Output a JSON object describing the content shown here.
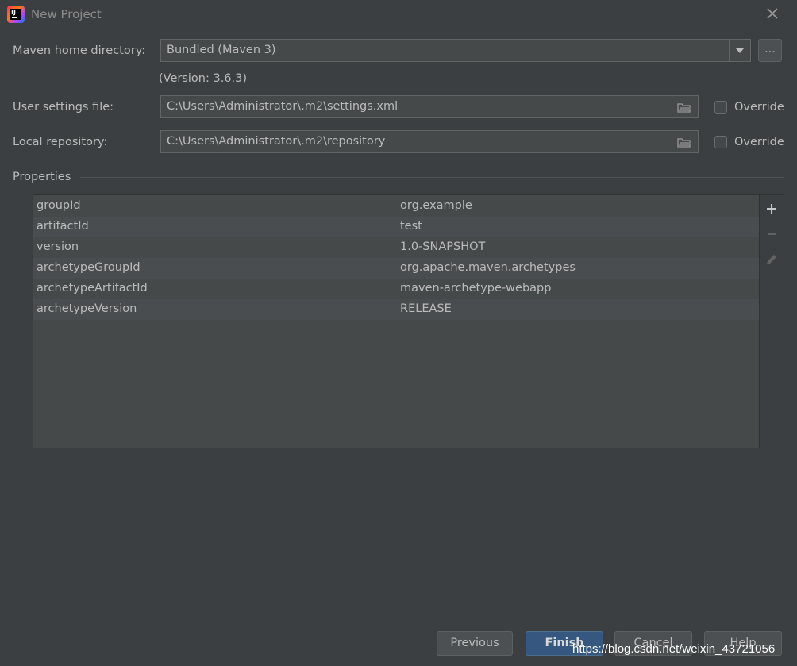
{
  "window": {
    "title": "New Project",
    "app_icon_text": "IJ"
  },
  "maven_home": {
    "label": "Maven home directory:",
    "value": "Bundled (Maven 3)",
    "version": "(Version: 3.6.3)",
    "browse_label": "..."
  },
  "user_settings": {
    "label": "User settings file:",
    "value": "C:\\Users\\Administrator\\.m2\\settings.xml",
    "override_label": "Override",
    "override_checked": false
  },
  "local_repo": {
    "label": "Local repository:",
    "value": "C:\\Users\\Administrator\\.m2\\repository",
    "override_label": "Override",
    "override_checked": false
  },
  "properties": {
    "title": "Properties",
    "rows": [
      {
        "key": "groupId",
        "value": "org.example"
      },
      {
        "key": "artifactId",
        "value": "test"
      },
      {
        "key": "version",
        "value": "1.0-SNAPSHOT"
      },
      {
        "key": "archetypeGroupId",
        "value": "org.apache.maven.archetypes"
      },
      {
        "key": "archetypeArtifactId",
        "value": "maven-archetype-webapp"
      },
      {
        "key": "archetypeVersion",
        "value": "RELEASE"
      }
    ],
    "tools": [
      "add-icon",
      "remove-icon",
      "edit-icon"
    ]
  },
  "buttons": {
    "previous": "Previous",
    "finish": "Finish",
    "cancel": "Cancel",
    "help": "Help"
  },
  "watermark": "https://blog.csdn.net/weixin_43721056",
  "colors": {
    "background": "#3c3f41",
    "field": "#45494a",
    "primary": "#365880",
    "text": "#bbbbbb"
  }
}
